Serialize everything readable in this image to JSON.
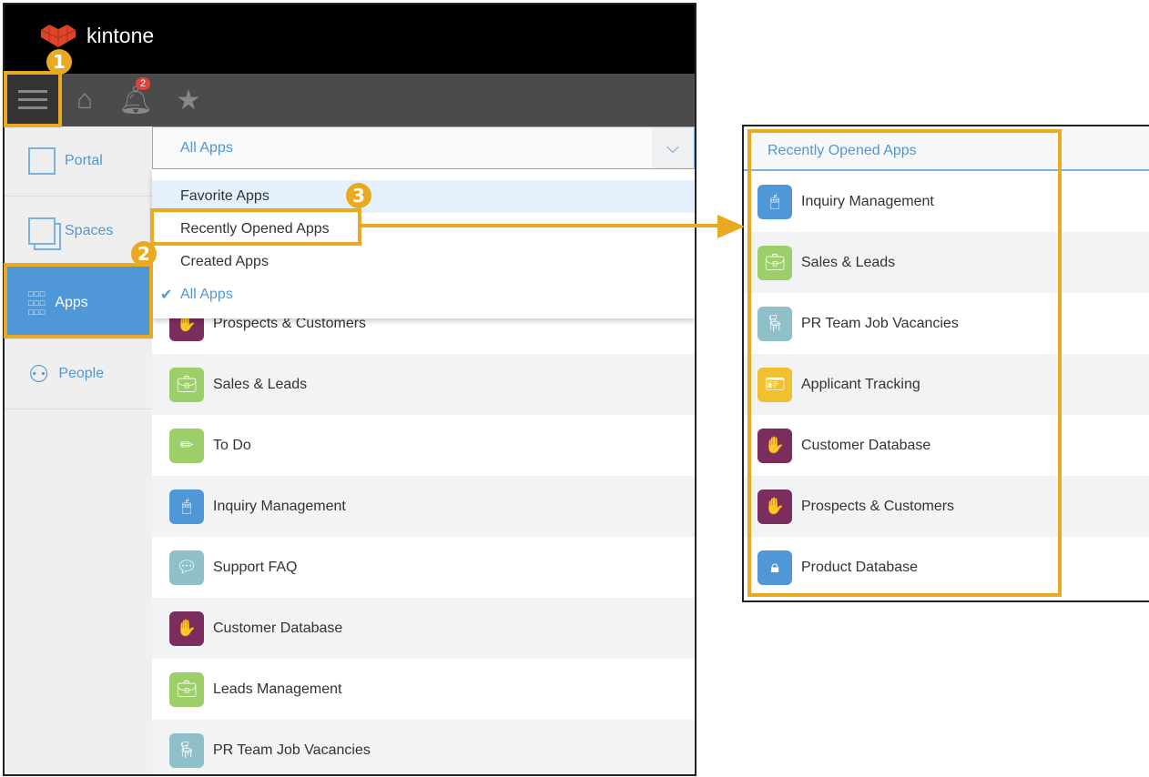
{
  "brand": {
    "name": "kintone",
    "accent": "#4f97d6",
    "annotation": "#e9a920"
  },
  "header": {
    "notification_count": "2"
  },
  "sidebar": {
    "items": [
      {
        "label": "Portal"
      },
      {
        "label": "Spaces"
      },
      {
        "label": "Apps"
      },
      {
        "label": "People"
      }
    ]
  },
  "select": {
    "value": "All Apps"
  },
  "dropdown": {
    "items": [
      {
        "label": "Favorite Apps"
      },
      {
        "label": "Recently Opened Apps"
      },
      {
        "label": "Created Apps"
      },
      {
        "label": "All Apps",
        "selected": true
      }
    ]
  },
  "apps": [
    {
      "name": "Prospects & Customers",
      "icon": "hand-icon",
      "color": "#7a2e5e"
    },
    {
      "name": "Sales & Leads",
      "icon": "briefcase-icon",
      "color": "#9ccf6a"
    },
    {
      "name": "To Do",
      "icon": "pencil-icon",
      "color": "#9ccf6a"
    },
    {
      "name": "Inquiry Management",
      "icon": "mouse-icon",
      "color": "#4f97d6"
    },
    {
      "name": "Support FAQ",
      "icon": "speech-bubble-icon",
      "color": "#8fbfc8"
    },
    {
      "name": "Customer Database",
      "icon": "hand-icon",
      "color": "#7a2e5e"
    },
    {
      "name": "Leads Management",
      "icon": "briefcase-icon",
      "color": "#9ccf6a"
    },
    {
      "name": "PR Team Job Vacancies",
      "icon": "office-chair-icon",
      "color": "#8fbfc8"
    }
  ],
  "recent": {
    "title": "Recently Opened Apps",
    "apps": [
      {
        "name": "Inquiry Management",
        "icon": "mouse-icon",
        "color": "#4f97d6"
      },
      {
        "name": "Sales & Leads",
        "icon": "briefcase-icon",
        "color": "#9ccf6a"
      },
      {
        "name": "PR Team Job Vacancies",
        "icon": "office-chair-icon",
        "color": "#8fbfc8"
      },
      {
        "name": "Applicant Tracking",
        "icon": "id-card-icon",
        "color": "#f0c030"
      },
      {
        "name": "Customer Database",
        "icon": "hand-icon",
        "color": "#7a2e5e"
      },
      {
        "name": "Prospects & Customers",
        "icon": "hand-icon",
        "color": "#7a2e5e"
      },
      {
        "name": "Product Database",
        "icon": "lock-icon",
        "color": "#4f97d6"
      }
    ]
  },
  "annotations": [
    "1",
    "2",
    "3"
  ]
}
